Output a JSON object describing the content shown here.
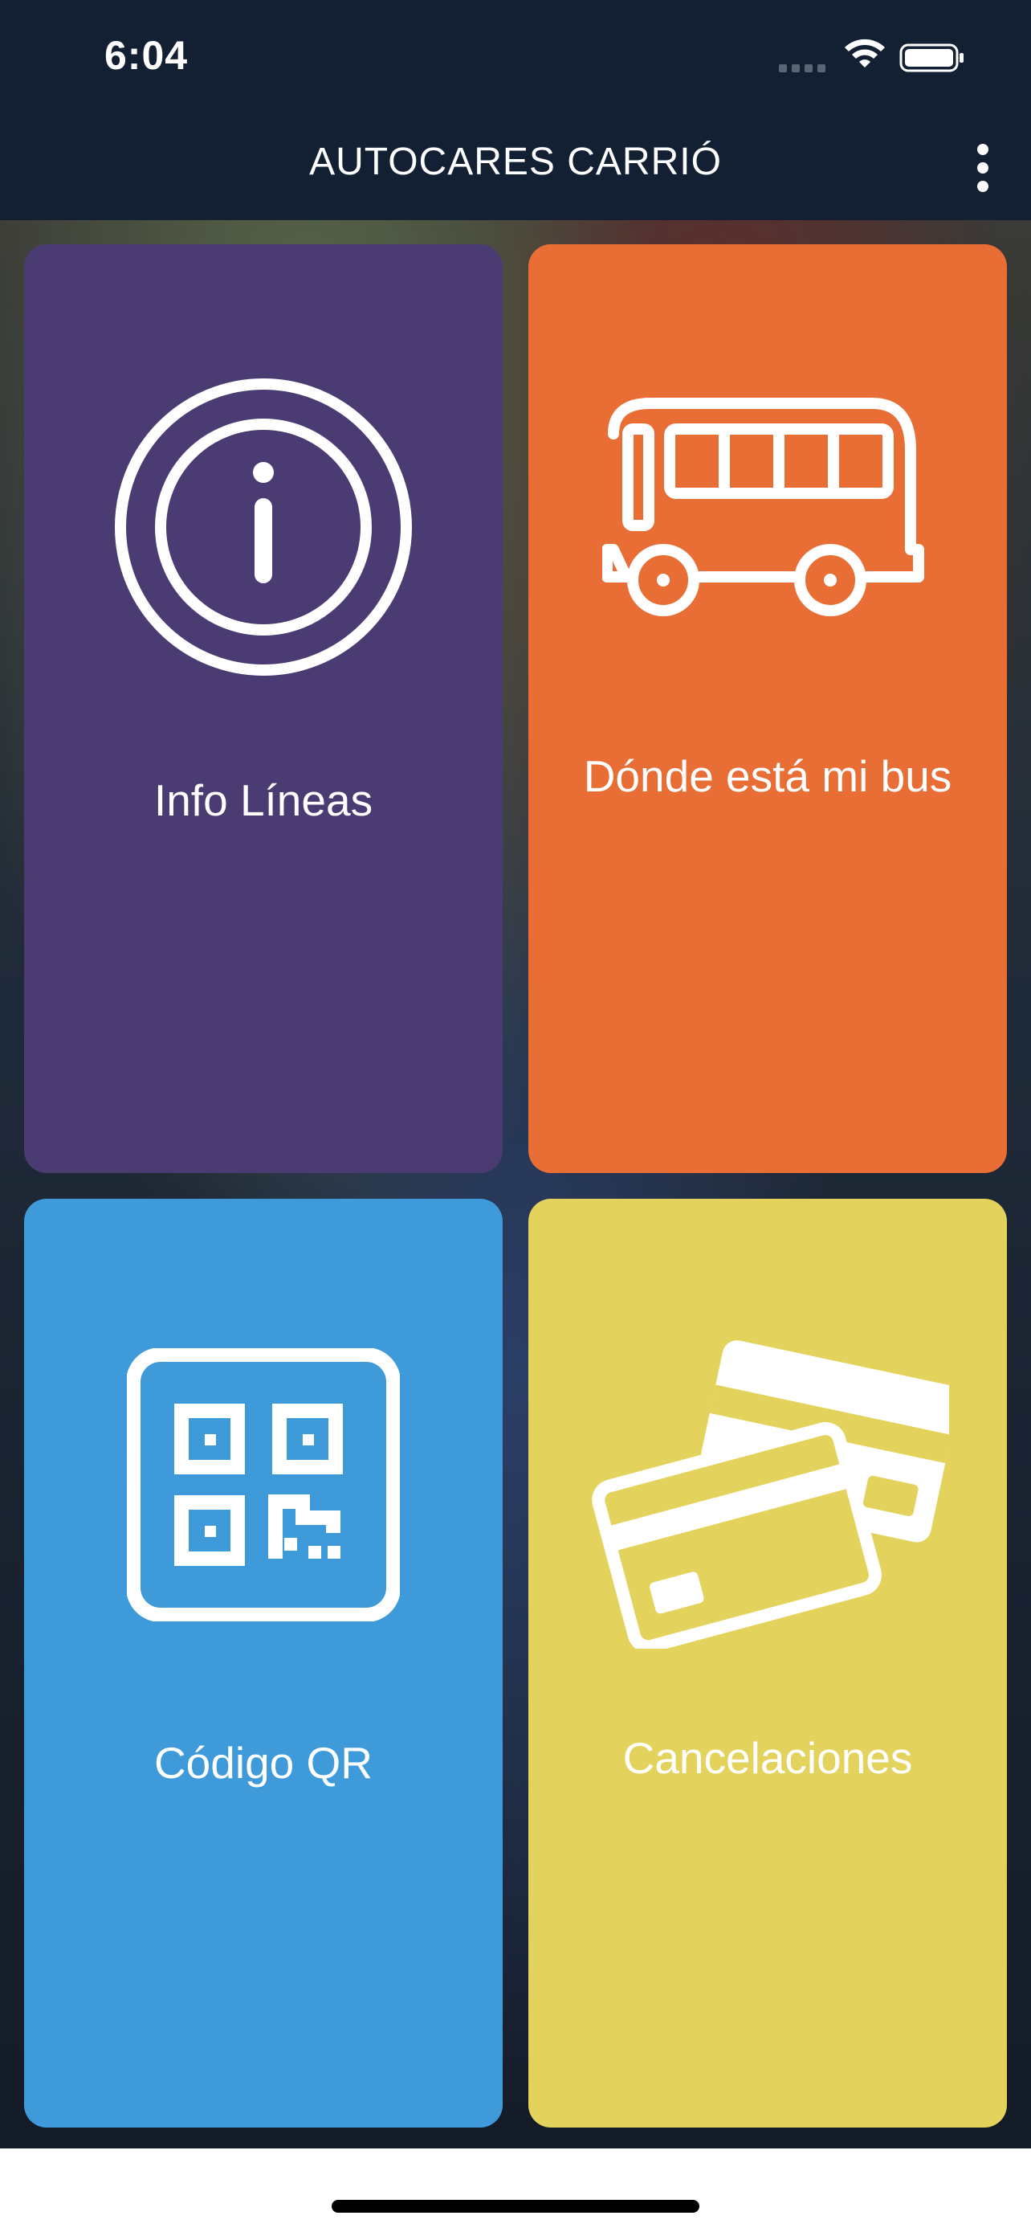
{
  "status_bar": {
    "time": "6:04"
  },
  "app_bar": {
    "title": "AUTOCARES CARRIÓ",
    "menu_icon": "more-vertical-icon"
  },
  "tiles": [
    {
      "label": "Info Líneas",
      "icon": "info-icon",
      "color": "#4b3b73"
    },
    {
      "label": "Dónde está mi bus",
      "icon": "bus-icon",
      "color": "#e96e35"
    },
    {
      "label": "Código QR",
      "icon": "qr-code-icon",
      "color": "#3e9ad8"
    },
    {
      "label": "Cancelaciones",
      "icon": "credit-cards-icon",
      "color": "#e3d25b"
    }
  ]
}
